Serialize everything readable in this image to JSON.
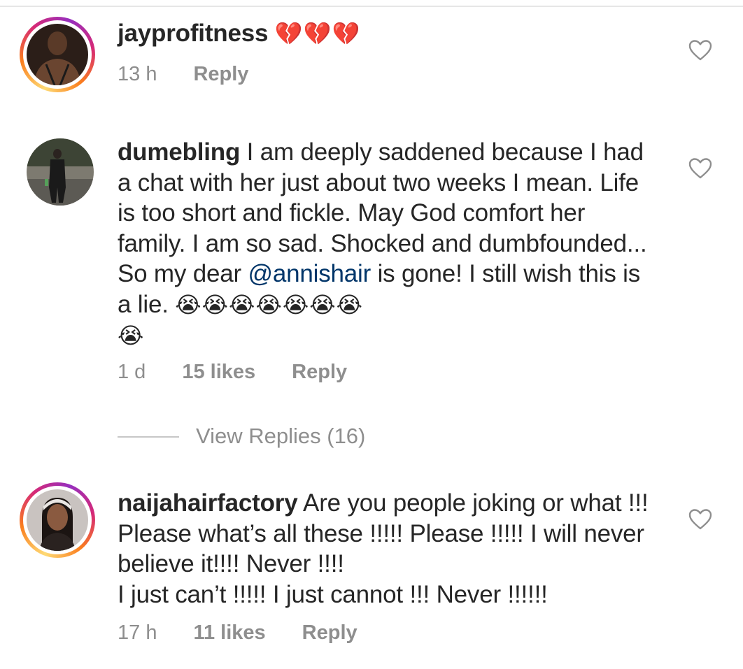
{
  "comments": [
    {
      "username": "jayprofitness",
      "text": "",
      "emoji": "💔💔💔",
      "time": "13 h",
      "likes": "",
      "reply_label": "Reply"
    },
    {
      "username": "dumebling",
      "text_before_mention": "I am deeply saddened because I had a chat with her just about two weeks I mean. Life is too short and fickle. May God comfort her family. I am so sad. Shocked and dumbfounded... So my dear ",
      "mention": "@annishair",
      "text_after_mention": " is gone! I still wish this is a lie. ",
      "emoji_line1": "😭😭😭😭😭😭😭",
      "emoji_line2": "😭",
      "time": "1 d",
      "likes": "15 likes",
      "reply_label": "Reply",
      "view_replies": "View Replies (16)"
    },
    {
      "username": "naijahairfactory",
      "text_line1": " Are you people joking or what !!! Please what’s all these !!!!! Please !!!!! I will never believe it!!!! Never !!!!",
      "text_line2": "I just can’t !!!!! I just cannot !!! Never !!!!!!",
      "time": "17 h",
      "likes": "11 likes",
      "reply_label": "Reply"
    }
  ],
  "icons": {
    "like": "heart-outline-icon"
  },
  "colors": {
    "text": "#262626",
    "meta": "#8e8e8e",
    "mention": "#003569",
    "divider": "#c7c7c7"
  }
}
